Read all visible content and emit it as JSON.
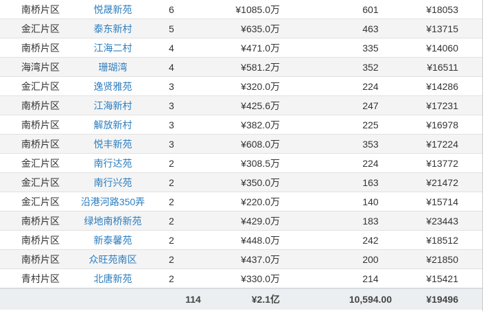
{
  "rows": [
    {
      "area": "南桥片区",
      "name": "悦晟新苑",
      "count": "6",
      "total_price": "¥1085.0万",
      "size": "601",
      "unit_price": "¥18053"
    },
    {
      "area": "金汇片区",
      "name": "泰东新村",
      "count": "5",
      "total_price": "¥635.0万",
      "size": "463",
      "unit_price": "¥13715"
    },
    {
      "area": "南桥片区",
      "name": "江海二村",
      "count": "4",
      "total_price": "¥471.0万",
      "size": "335",
      "unit_price": "¥14060"
    },
    {
      "area": "海湾片区",
      "name": "珊瑚湾",
      "count": "4",
      "total_price": "¥581.2万",
      "size": "352",
      "unit_price": "¥16511"
    },
    {
      "area": "金汇片区",
      "name": "逸贤雅苑",
      "count": "3",
      "total_price": "¥320.0万",
      "size": "224",
      "unit_price": "¥14286"
    },
    {
      "area": "南桥片区",
      "name": "江海新村",
      "count": "3",
      "total_price": "¥425.6万",
      "size": "247",
      "unit_price": "¥17231"
    },
    {
      "area": "南桥片区",
      "name": "解放新村",
      "count": "3",
      "total_price": "¥382.0万",
      "size": "225",
      "unit_price": "¥16978"
    },
    {
      "area": "南桥片区",
      "name": "悦丰新苑",
      "count": "3",
      "total_price": "¥608.0万",
      "size": "353",
      "unit_price": "¥17224"
    },
    {
      "area": "金汇片区",
      "name": "南行达苑",
      "count": "2",
      "total_price": "¥308.5万",
      "size": "224",
      "unit_price": "¥13772"
    },
    {
      "area": "金汇片区",
      "name": "南行兴苑",
      "count": "2",
      "total_price": "¥350.0万",
      "size": "163",
      "unit_price": "¥21472"
    },
    {
      "area": "金汇片区",
      "name": "沿港河路350弄",
      "count": "2",
      "total_price": "¥220.0万",
      "size": "140",
      "unit_price": "¥15714"
    },
    {
      "area": "南桥片区",
      "name": "绿地南桥新苑",
      "count": "2",
      "total_price": "¥429.0万",
      "size": "183",
      "unit_price": "¥23443"
    },
    {
      "area": "南桥片区",
      "name": "新泰馨苑",
      "count": "2",
      "total_price": "¥448.0万",
      "size": "242",
      "unit_price": "¥18512"
    },
    {
      "area": "南桥片区",
      "name": "众旺苑南区",
      "count": "2",
      "total_price": "¥437.0万",
      "size": "200",
      "unit_price": "¥21850"
    },
    {
      "area": "青村片区",
      "name": "北唐新苑",
      "count": "2",
      "total_price": "¥330.0万",
      "size": "214",
      "unit_price": "¥15421"
    }
  ],
  "totals": {
    "count": "114",
    "total_price": "¥2.1亿",
    "size": "10,594.00",
    "unit_price": "¥19496"
  },
  "colors": {
    "link": "#2b7dbf",
    "stripe": "#f4f4f4",
    "footer": "#eceff2"
  }
}
